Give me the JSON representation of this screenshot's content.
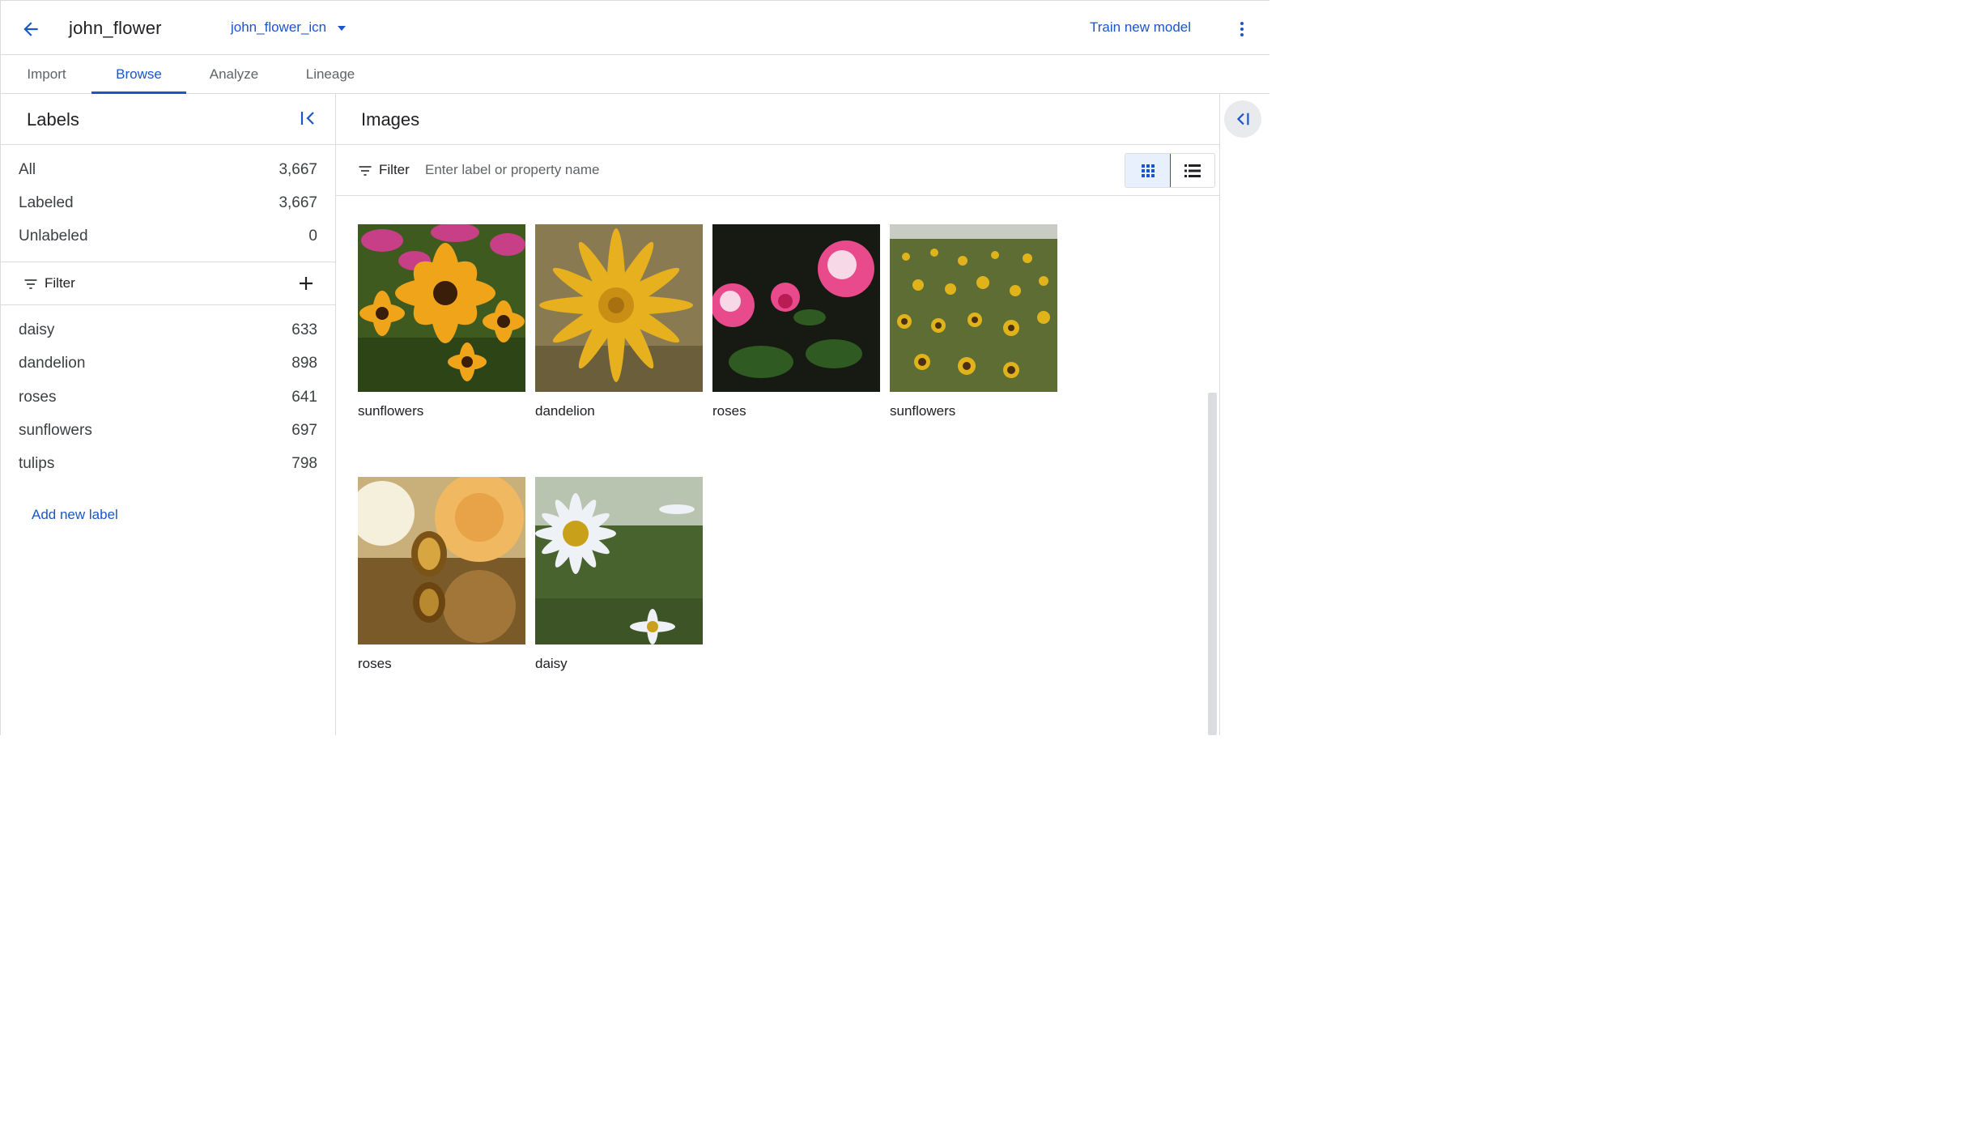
{
  "header": {
    "dataset_name": "john_flower",
    "dataset_select": "john_flower_icn",
    "train_button": "Train new model"
  },
  "tabs": [
    {
      "label": "Import",
      "active": false
    },
    {
      "label": "Browse",
      "active": true
    },
    {
      "label": "Analyze",
      "active": false
    },
    {
      "label": "Lineage",
      "active": false
    }
  ],
  "labels_panel": {
    "title": "Labels",
    "counts": [
      {
        "label": "All",
        "value": "3,667"
      },
      {
        "label": "Labeled",
        "value": "3,667"
      },
      {
        "label": "Unlabeled",
        "value": "0"
      }
    ],
    "filter_label": "Filter",
    "labels": [
      {
        "label": "daisy",
        "value": "633"
      },
      {
        "label": "dandelion",
        "value": "898"
      },
      {
        "label": "roses",
        "value": "641"
      },
      {
        "label": "sunflowers",
        "value": "697"
      },
      {
        "label": "tulips",
        "value": "798"
      }
    ],
    "add_label": "Add new label"
  },
  "images_panel": {
    "title": "Images",
    "filter_label": "Filter",
    "filter_placeholder": "Enter label or property name",
    "view_mode": "grid",
    "images": [
      {
        "label": "sunflowers",
        "scene": "black-eyed-susans"
      },
      {
        "label": "dandelion",
        "scene": "dandelion-closeup"
      },
      {
        "label": "roses",
        "scene": "pink-roses-dark"
      },
      {
        "label": "sunflowers",
        "scene": "sunflower-field"
      },
      {
        "label": "roses",
        "scene": "yellow-rose-jewelry"
      },
      {
        "label": "daisy",
        "scene": "white-daisy"
      }
    ]
  },
  "colors": {
    "accent": "#1a56c9",
    "border": "#dadce0",
    "text": "#202124",
    "muted": "#5f6368"
  },
  "icons": [
    "back-arrow-icon",
    "caret-down-icon",
    "more-vert-icon",
    "collapse-left-icon",
    "filter-icon",
    "plus-icon",
    "grid-view-icon",
    "list-view-icon",
    "expand-panel-icon"
  ]
}
